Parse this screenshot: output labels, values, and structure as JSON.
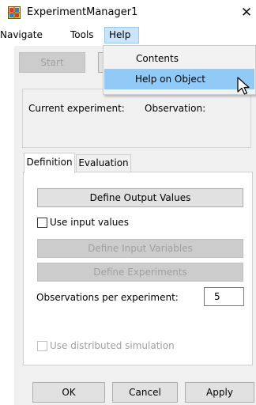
{
  "window": {
    "title": "ExperimentManager1",
    "close_symbol": "✕"
  },
  "menubar": {
    "items": [
      {
        "label": "Navigate"
      },
      {
        "label": "Tools"
      },
      {
        "label": "Help"
      }
    ]
  },
  "help_menu": {
    "items": [
      {
        "label": "Contents"
      },
      {
        "label": "Help on Object",
        "highlighted": true
      }
    ]
  },
  "toolbar": {
    "start_label": "Start"
  },
  "status": {
    "current_experiment_label": "Current experiment:",
    "observation_label": "Observation:"
  },
  "tabs": [
    {
      "label": "Definition",
      "active": true
    },
    {
      "label": "Evaluation",
      "active": false
    }
  ],
  "definition": {
    "define_output_label": "Define Output Values",
    "use_input_label": "Use input values",
    "use_input_checked": false,
    "define_input_label": "Define Input Variables",
    "define_experiments_label": "Define Experiments",
    "obs_per_exp_label": "Observations per experiment:",
    "obs_per_exp_value": "5",
    "distributed_label": "Use distributed simulation",
    "distributed_checked": false
  },
  "footer": {
    "ok_label": "OK",
    "cancel_label": "Cancel",
    "apply_label": "Apply"
  },
  "colors": {
    "menu_highlight": "#91c9f7",
    "help_menu_active": "#cce4f7"
  },
  "icons": {
    "app": "experiment-manager-icon",
    "cursor": "mouse-pointer-icon"
  }
}
